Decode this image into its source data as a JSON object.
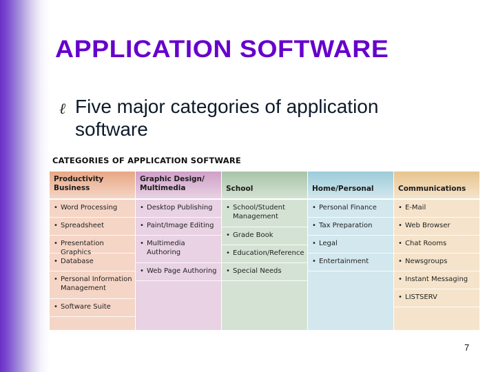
{
  "slide": {
    "title": "APPLICATION SOFTWARE",
    "bullet_icon": "leo-bullet-icon",
    "bullet_glyph": "ℓ",
    "bullet_text": "Five major categories of application software",
    "page_number": "7",
    "accent_color": "#6600cc"
  },
  "table": {
    "caption": "CATEGORIES OF APPLICATION SOFTWARE",
    "columns": [
      {
        "header": "Productivity Business",
        "header_lines": [
          "Productivity",
          "Business"
        ],
        "header_color": "#e8a783",
        "body_color": "#f5d5c6",
        "items": [
          "Word Processing",
          "Spreadsheet",
          "Presentation Graphics",
          "Database",
          "Personal Information Management",
          "Software Suite"
        ]
      },
      {
        "header": "Graphic Design/ Multimedia",
        "header_lines": [
          "Graphic Design/",
          "Multimedia"
        ],
        "header_color": "#cf9fc8",
        "body_color": "#e8d2e3",
        "items": [
          "Desktop Publishing",
          "Paint/Image Editing",
          "Multimedia Authoring",
          "Web Page Authoring"
        ]
      },
      {
        "header": "School",
        "header_lines": [
          "School"
        ],
        "header_color": "#a8c4a8",
        "body_color": "#d4e2d4",
        "items": [
          "School/Student Management",
          "Grade Book",
          "Education/Reference",
          "Special Needs"
        ]
      },
      {
        "header": "Home/Personal",
        "header_lines": [
          "Home/Personal"
        ],
        "header_color": "#9cccd8",
        "body_color": "#d2e7ee",
        "items": [
          "Personal Finance",
          "Tax Preparation",
          "Legal",
          "Entertainment"
        ]
      },
      {
        "header": "Communications",
        "header_lines": [
          "Communications"
        ],
        "header_color": "#e8c48e",
        "body_color": "#f5e4cb",
        "items": [
          "E-Mail",
          "Web Browser",
          "Chat Rooms",
          "Newsgroups",
          "Instant Messaging",
          "LISTSERV"
        ]
      }
    ]
  }
}
